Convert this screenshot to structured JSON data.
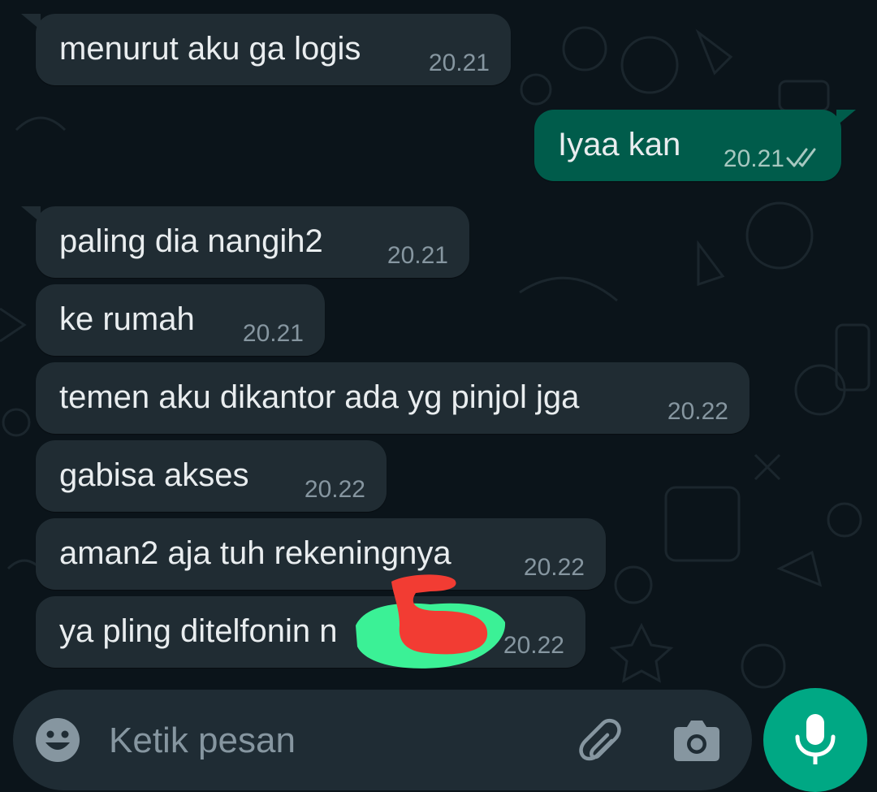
{
  "messages": [
    {
      "direction": "in",
      "text": "menurut aku ga logis",
      "time": "20.21"
    },
    {
      "direction": "out",
      "text": "Iyaa kan",
      "time": "20.21",
      "status": "read"
    },
    {
      "direction": "in",
      "text": "paling dia nangih2",
      "time": "20.21"
    },
    {
      "direction": "in",
      "text": "ke rumah",
      "time": "20.21"
    },
    {
      "direction": "in",
      "text": "temen aku dikantor ada yg pinjol jga",
      "time": "20.22"
    },
    {
      "direction": "in",
      "text": "gabisa akses",
      "time": "20.22"
    },
    {
      "direction": "in",
      "text": "aman2 aja tuh rekeningnya",
      "time": "20.22"
    },
    {
      "direction": "in",
      "text": "ya pling ditelfonin n",
      "time": "20.22"
    }
  ],
  "composer": {
    "placeholder": "Ketik pesan",
    "emoji_icon": "emoji-icon",
    "attach_icon": "paperclip-icon",
    "camera_icon": "camera-icon",
    "mic_icon": "microphone-icon"
  },
  "colors": {
    "background": "#0b141a",
    "incoming_bubble": "#202c33",
    "outgoing_bubble": "#005c4b",
    "text": "#e9edef",
    "meta": "#8696a0",
    "accent": "#00a884",
    "redaction_green": "#3dfc9c",
    "redaction_red": "#f23c33"
  }
}
